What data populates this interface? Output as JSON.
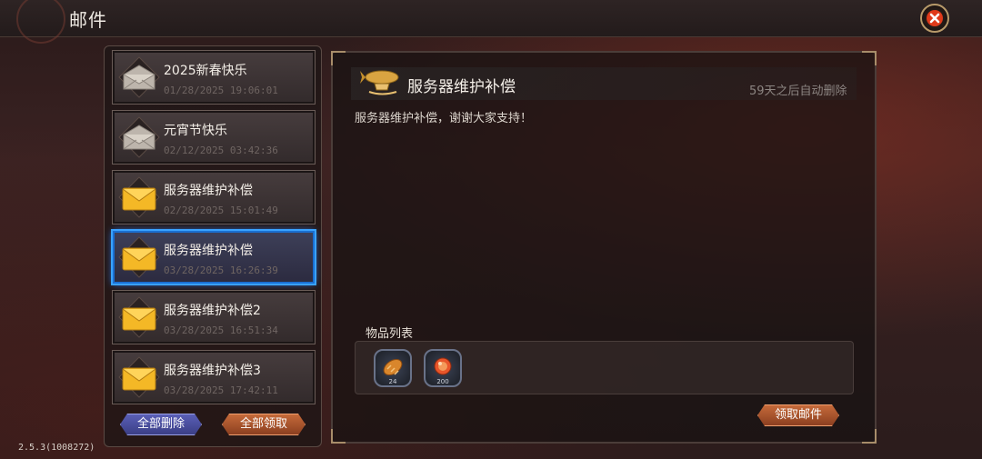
{
  "header": {
    "title": "邮件"
  },
  "mail_list": [
    {
      "subject": "2025新春快乐",
      "date": "01/28/2025 19:06:01",
      "read": true
    },
    {
      "subject": "元宵节快乐",
      "date": "02/12/2025 03:42:36",
      "read": true
    },
    {
      "subject": "服务器维护补偿",
      "date": "02/28/2025 15:01:49",
      "read": false
    },
    {
      "subject": "服务器维护补偿",
      "date": "03/28/2025 16:26:39",
      "read": false,
      "selected": true
    },
    {
      "subject": "服务器维护补偿2",
      "date": "03/28/2025 16:51:34",
      "read": false
    },
    {
      "subject": "服务器维护补偿3",
      "date": "03/28/2025 17:42:11",
      "read": false
    }
  ],
  "list_buttons": {
    "delete_all": "全部删除",
    "claim_all": "全部领取"
  },
  "detail": {
    "title": "服务器维护补偿",
    "expire": "59天之后自动删除",
    "body": "服务器维护补偿，谢谢大家支持！",
    "items_label": "物品列表",
    "items": [
      {
        "icon": "bread-icon",
        "count": "24"
      },
      {
        "icon": "gem-icon",
        "count": "200"
      }
    ],
    "claim_button": "领取邮件"
  },
  "footer": {
    "version": "2.5.3(1008272)"
  },
  "colors": {
    "accent_blue": "#3aa2ff",
    "button_orange": "#c56a3a",
    "button_purple": "#5a5fb6",
    "close_red": "#e03a1a"
  }
}
